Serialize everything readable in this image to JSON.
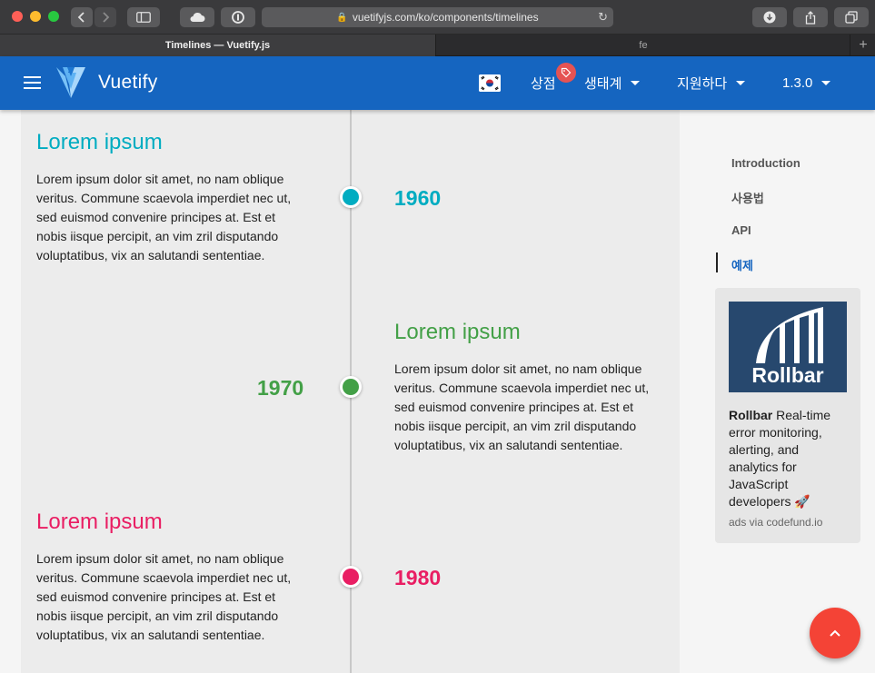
{
  "browser": {
    "url": "vuetifyjs.com/ko/components/timelines",
    "tabs": [
      {
        "label": "Timelines — Vuetify.js",
        "active": true
      },
      {
        "label": "fe",
        "active": false
      }
    ],
    "new_tab_label": "+"
  },
  "appbar": {
    "brand": "Vuetify",
    "store_label": "상점",
    "ecosystem_label": "생태계",
    "support_label": "지원하다",
    "version_label": "1.3.0",
    "color": "#1565c0"
  },
  "timeline": [
    {
      "title": "Lorem ipsum",
      "text": "Lorem ipsum dolor sit amet, no nam oblique veritus. Commune scaevola imperdiet nec ut, sed euismod convenire principes at. Est et nobis iisque percipit, an vim zril disputando voluptatibus, vix an salutandi sententiae.",
      "year": "1960",
      "color": "#00acc1"
    },
    {
      "title": "Lorem ipsum",
      "text": "Lorem ipsum dolor sit amet, no nam oblique veritus. Commune scaevola imperdiet nec ut, sed euismod convenire principes at. Est et nobis iisque percipit, an vim zril disputando voluptatibus, vix an salutandi sententiae.",
      "year": "1970",
      "color": "#43a047"
    },
    {
      "title": "Lorem ipsum",
      "text": "Lorem ipsum dolor sit amet, no nam oblique veritus. Commune scaevola imperdiet nec ut, sed euismod convenire principes at. Est et nobis iisque percipit, an vim zril disputando voluptatibus, vix an salutandi sententiae.",
      "year": "1980",
      "color": "#e91e63"
    }
  ],
  "toc": {
    "items": [
      "Introduction",
      "사용법",
      "API",
      "예제"
    ],
    "active_index": 3,
    "active_color": "#1565c0"
  },
  "ad": {
    "logo_word": "Rollbar",
    "brand": "Rollbar",
    "text": " Real-time error monitoring, alerting, and analytics for JavaScript developers 🚀",
    "via": "ads via codefund.io"
  },
  "fab": {
    "icon": "chevron-up-icon",
    "color": "#f44336"
  }
}
